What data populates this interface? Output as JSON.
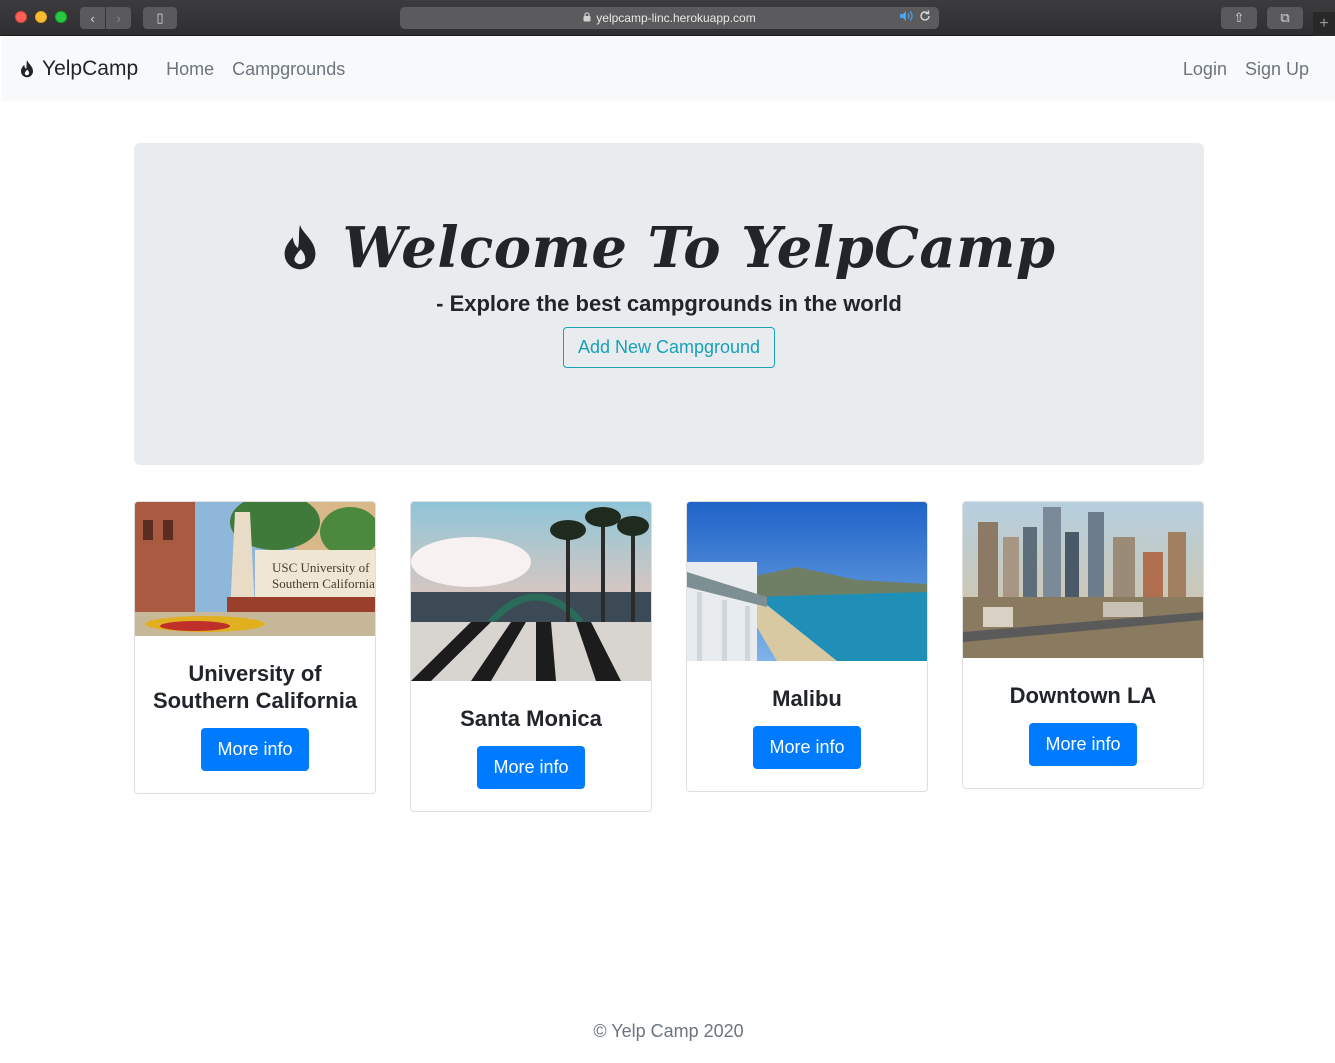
{
  "browser": {
    "url": "yelpcamp-linc.herokuapp.com",
    "lock_icon": "lock-icon",
    "audio_icon": "speaker-icon",
    "reload_icon": "reload-icon",
    "back_glyph": "‹",
    "forward_glyph": "›",
    "sidebar_glyph": "▯",
    "share_glyph": "⇧",
    "tabs_glyph": "⧉",
    "newtab_glyph": "+"
  },
  "navbar": {
    "brand": "YelpCamp",
    "brand_icon": "fire-icon",
    "links": [
      "Home",
      "Campgrounds"
    ],
    "right_links": [
      "Login",
      "Sign Up"
    ]
  },
  "hero": {
    "title": "Welcome To YelpCamp",
    "title_icon": "fire-icon",
    "subtitle": "- Explore the best campgrounds in the world",
    "button": "Add New Campground"
  },
  "cards": [
    {
      "title": "University of Southern California",
      "button": "More info"
    },
    {
      "title": "Santa Monica",
      "button": "More info"
    },
    {
      "title": "Malibu",
      "button": "More info"
    },
    {
      "title": "Downtown LA",
      "button": "More info"
    }
  ],
  "card_image_text": {
    "usc_sign_line1": "USC University of",
    "usc_sign_line2": "Southern California"
  },
  "footer": {
    "text": "© Yelp Camp 2020"
  },
  "colors": {
    "primary": "#007bff",
    "info": "#17a2b8",
    "jumbotron": "#e9ecef",
    "navbar": "#f8f9fa",
    "muted": "#6c757d"
  }
}
